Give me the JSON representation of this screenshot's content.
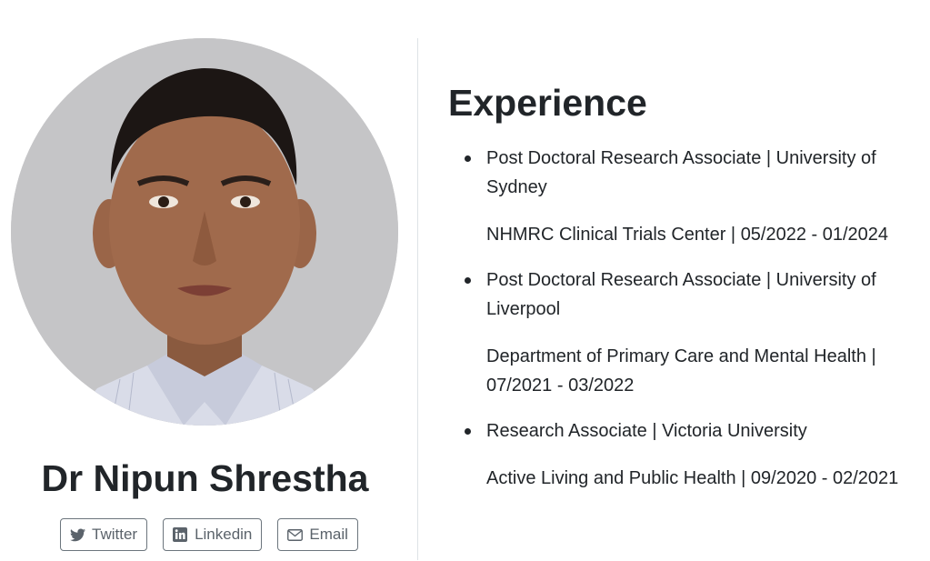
{
  "profile": {
    "name": "Dr Nipun Shrestha",
    "photo_alt": "Profile photo",
    "social": [
      {
        "label": "Twitter",
        "icon": "twitter-icon"
      },
      {
        "label": "Linkedin",
        "icon": "linkedin-icon"
      },
      {
        "label": "Email",
        "icon": "envelope-icon"
      }
    ]
  },
  "experience": {
    "title": "Experience",
    "items": [
      {
        "role": "Post Doctoral Research Associate | University of Sydney",
        "detail": "NHMRC Clinical Trials Center | 05/2022 - 01/2024"
      },
      {
        "role": "Post Doctoral Research Associate | University of Liverpool",
        "detail": "Department of Primary Care and Mental Health | 07/2021 - 03/2022"
      },
      {
        "role": "Research Associate | Victoria University",
        "detail": "Active Living and Public Health | 09/2020 - 02/2021"
      }
    ]
  },
  "colors": {
    "text": "#212529",
    "button_text": "#5b636b",
    "button_border": "#6c757d",
    "divider": "#dee2e6",
    "photo_background": "#c6c6c8"
  }
}
